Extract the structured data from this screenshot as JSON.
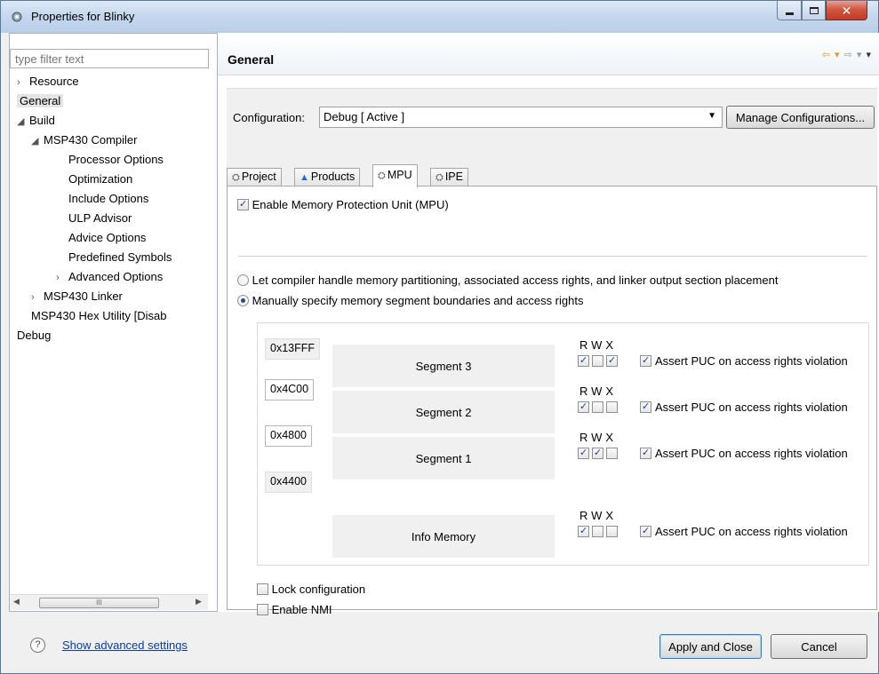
{
  "window": {
    "title": "Properties for Blinky"
  },
  "left": {
    "filter_placeholder": "type filter text",
    "tree": [
      {
        "label": "Resource",
        "arrow": "›",
        "indent": 0
      },
      {
        "label": "General",
        "arrow": "",
        "indent": 0,
        "selected": true
      },
      {
        "label": "Build",
        "arrow": "◢",
        "indent": 0
      },
      {
        "label": "MSP430 Compiler",
        "arrow": "◢",
        "indent": 1
      },
      {
        "label": "Processor Options",
        "arrow": "",
        "indent": 2
      },
      {
        "label": "Optimization",
        "arrow": "",
        "indent": 2
      },
      {
        "label": "Include Options",
        "arrow": "",
        "indent": 2
      },
      {
        "label": "ULP Advisor",
        "arrow": "",
        "indent": 2
      },
      {
        "label": "Advice Options",
        "arrow": "",
        "indent": 2
      },
      {
        "label": "Predefined Symbols",
        "arrow": "",
        "indent": 2
      },
      {
        "label": "Advanced Options",
        "arrow": "›",
        "indent": 2
      },
      {
        "label": "MSP430 Linker",
        "arrow": "›",
        "indent": 1
      },
      {
        "label": "MSP430 Hex Utility  [Disab",
        "arrow": "",
        "indent": 1
      },
      {
        "label": "Debug",
        "arrow": "",
        "indent": 0
      }
    ],
    "scroll_thumb": "III"
  },
  "right": {
    "page_title": "General",
    "configuration_label": "Configuration:",
    "configuration_value": "Debug  [ Active ]",
    "manage_label": "Manage Configurations...",
    "tabs": [
      {
        "label": "Project",
        "icon": "project-icon"
      },
      {
        "label": "Products",
        "icon": "products-icon"
      },
      {
        "label": "MPU",
        "icon": "mpu-icon",
        "active": true
      },
      {
        "label": "IPE",
        "icon": "ipe-icon"
      }
    ],
    "mpu": {
      "enable_label": "Enable Memory Protection Unit (MPU)",
      "enable_checked": true,
      "radio_auto": "Let compiler handle memory partitioning, associated access rights, and linker output section placement",
      "radio_manual": "Manually specify memory segment boundaries and access rights",
      "selected_radio": "manual",
      "addresses": [
        "0x13FFF",
        "0x4C00",
        "0x4800",
        "0x4400"
      ],
      "rwx_header": "RWX",
      "assert_label": "Assert PUC on access rights violation",
      "segments": [
        {
          "name": "Segment 3",
          "r": true,
          "w": false,
          "x": true,
          "assert": true
        },
        {
          "name": "Segment 2",
          "r": true,
          "w": false,
          "x": false,
          "assert": true
        },
        {
          "name": "Segment 1",
          "r": true,
          "w": true,
          "x": false,
          "assert": true
        },
        {
          "name": "Info Memory",
          "r": true,
          "w": false,
          "x": false,
          "assert": true
        }
      ],
      "lock_label": "Lock configuration",
      "lock_checked": false,
      "nmi_label": "Enable NMI",
      "nmi_checked": false
    }
  },
  "bottom": {
    "advanced_link": "Show advanced settings",
    "apply_label": "Apply and Close",
    "cancel_label": "Cancel"
  },
  "colors": {
    "link": "#0b3ea8",
    "check": "#1e3f8f",
    "titlebar": "#c6d8ee"
  }
}
